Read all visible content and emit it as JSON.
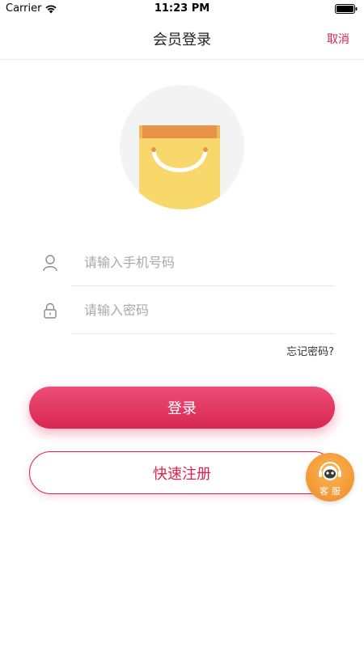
{
  "status_bar": {
    "carrier": "Carrier",
    "time": "11:23 PM"
  },
  "nav": {
    "title": "会员登录",
    "cancel_label": "取消"
  },
  "form": {
    "phone_placeholder": "请输入手机号码",
    "password_placeholder": "请输入密码",
    "forgot_label": "忘记密码?"
  },
  "buttons": {
    "login_label": "登录",
    "register_label": "快速注册"
  },
  "service": {
    "label": "客服"
  },
  "colors": {
    "accent": "#e0224f",
    "bag_body": "#f9d86b",
    "bag_inner": "#e8934a",
    "service": "#f4a03c"
  }
}
